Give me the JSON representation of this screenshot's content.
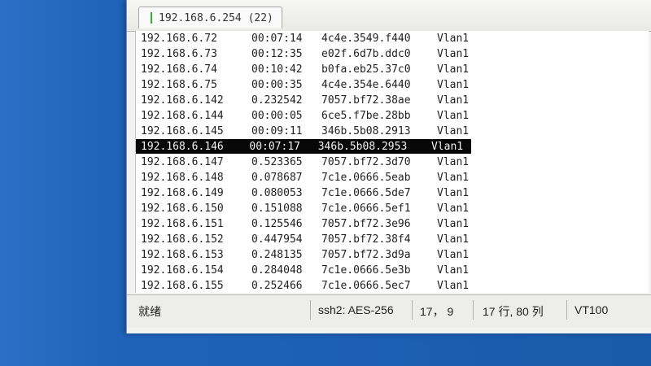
{
  "tab": {
    "title": "192.168.6.254 (22)",
    "status_color": "#2bb52b"
  },
  "terminal": {
    "highlight_color": "#080808",
    "rows": [
      {
        "ip": "192.168.6.72",
        "age": "00:07:14",
        "mac": "4c4e.3549.f440",
        "iface": "Vlan1"
      },
      {
        "ip": "192.168.6.73",
        "age": "00:12:35",
        "mac": "e02f.6d7b.ddc0",
        "iface": "Vlan1"
      },
      {
        "ip": "192.168.6.74",
        "age": "00:10:42",
        "mac": "b0fa.eb25.37c0",
        "iface": "Vlan1"
      },
      {
        "ip": "192.168.6.75",
        "age": "00:00:35",
        "mac": "4c4e.354e.6440",
        "iface": "Vlan1"
      },
      {
        "ip": "192.168.6.142",
        "age": "0.232542",
        "mac": "7057.bf72.38ae",
        "iface": "Vlan1"
      },
      {
        "ip": "192.168.6.144",
        "age": "00:00:05",
        "mac": "6ce5.f7be.28bb",
        "iface": "Vlan1"
      },
      {
        "ip": "192.168.6.145",
        "age": "00:09:11",
        "mac": "346b.5b08.2913",
        "iface": "Vlan1"
      },
      {
        "ip": "192.168.6.146",
        "age": "00:07:17",
        "mac": "346b.5b08.2953",
        "iface": "Vlan1",
        "highlight": true
      },
      {
        "ip": "192.168.6.147",
        "age": "0.523365",
        "mac": "7057.bf72.3d70",
        "iface": "Vlan1"
      },
      {
        "ip": "192.168.6.148",
        "age": "0.078687",
        "mac": "7c1e.0666.5eab",
        "iface": "Vlan1"
      },
      {
        "ip": "192.168.6.149",
        "age": "0.080053",
        "mac": "7c1e.0666.5de7",
        "iface": "Vlan1"
      },
      {
        "ip": "192.168.6.150",
        "age": "0.151088",
        "mac": "7c1e.0666.5ef1",
        "iface": "Vlan1"
      },
      {
        "ip": "192.168.6.151",
        "age": "0.125546",
        "mac": "7057.bf72.3e96",
        "iface": "Vlan1"
      },
      {
        "ip": "192.168.6.152",
        "age": "0.447954",
        "mac": "7057.bf72.38f4",
        "iface": "Vlan1"
      },
      {
        "ip": "192.168.6.153",
        "age": "0.248135",
        "mac": "7057.bf72.3d9a",
        "iface": "Vlan1"
      },
      {
        "ip": "192.168.6.154",
        "age": "0.284048",
        "mac": "7c1e.0666.5e3b",
        "iface": "Vlan1"
      },
      {
        "ip": "192.168.6.155",
        "age": "0.252466",
        "mac": "7c1e.0666.5ec7",
        "iface": "Vlan1"
      }
    ]
  },
  "statusbar": {
    "ready": "就绪",
    "protocol": "ssh2: AES-256",
    "cursor_pos": "17， 9",
    "size": "17 行, 80 列",
    "terminal_type": "VT100"
  }
}
